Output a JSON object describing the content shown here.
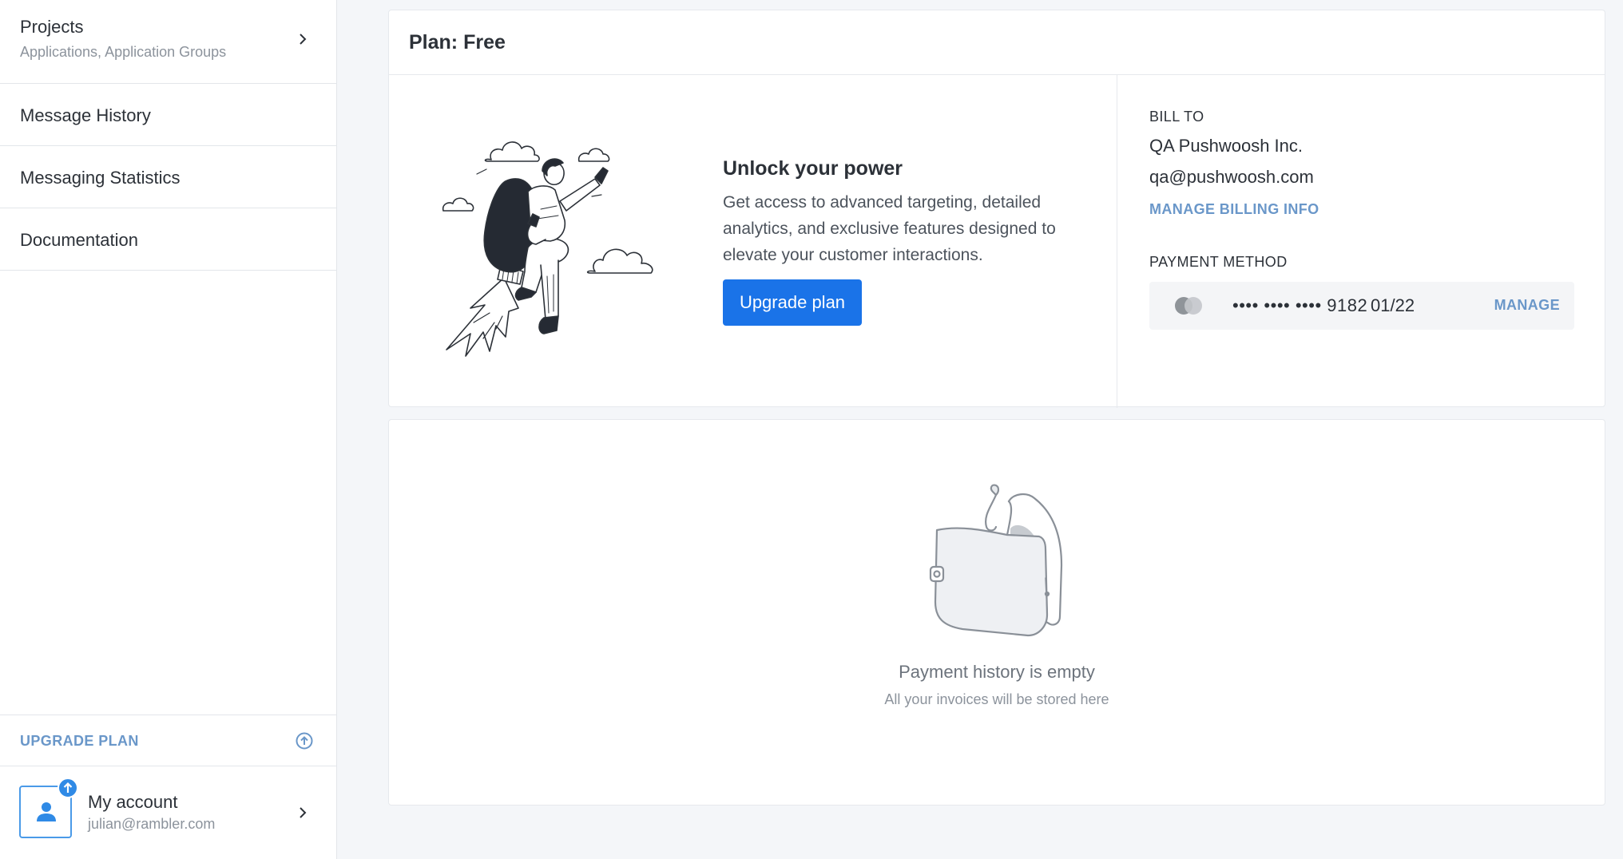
{
  "sidebar": {
    "projects": {
      "title": "Projects",
      "subtitle": "Applications, Application Groups"
    },
    "items": [
      {
        "label": "Message History"
      },
      {
        "label": "Messaging Statistics"
      },
      {
        "label": "Documentation"
      }
    ],
    "upgrade": {
      "label": "UPGRADE PLAN"
    },
    "account": {
      "name": "My account",
      "email": "julian@rambler.com"
    }
  },
  "plan": {
    "title": "Plan: Free",
    "promo": {
      "title": "Unlock your power",
      "description": "Get access to advanced targeting, detailed analytics, and exclusive features designed to elevate your customer interactions.",
      "button": "Upgrade plan"
    },
    "billing": {
      "bill_to_label": "BILL TO",
      "company": "QA Pushwoosh Inc.",
      "email": "qa@pushwoosh.com",
      "manage_billing": "MANAGE BILLING INFO",
      "payment_method_label": "PAYMENT METHOD",
      "card_number": "•••• •••• •••• 9182",
      "card_expiry": "01/22",
      "card_manage": "MANAGE",
      "card_brand_icon": "card-brand-icon"
    }
  },
  "history": {
    "empty_title": "Payment history is empty",
    "empty_subtitle": "All your invoices will be stored here"
  },
  "colors": {
    "accent": "#1a73e8",
    "link": "#6a97c9",
    "background": "#f4f6f9"
  }
}
